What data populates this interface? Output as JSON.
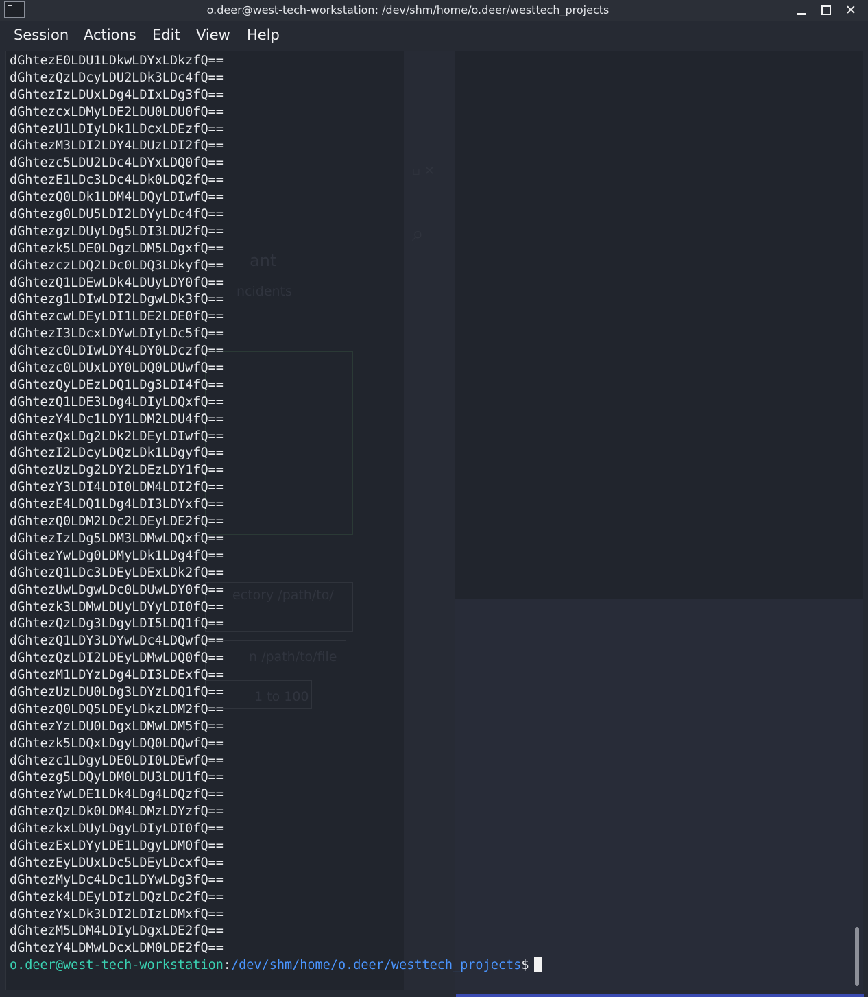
{
  "window": {
    "title": "o.deer@west-tech-workstation: /dev/shm/home/o.deer/westtech_projects",
    "app_icon": "terminal-icon",
    "controls": [
      "minimize-icon",
      "maximize-icon",
      "close-icon"
    ]
  },
  "menu": {
    "items": [
      "Session",
      "Actions",
      "Edit",
      "View",
      "Help"
    ]
  },
  "terminal": {
    "lines": [
      "dGhtezE0LDU1LDkwLDYxLDkzfQ==",
      "dGhtezQzLDcyLDU2LDk3LDc4fQ==",
      "dGhtezIzLDUxLDg4LDIxLDg3fQ==",
      "dGhtezcxLDMyLDE2LDU0LDU0fQ==",
      "dGhtezU1LDIyLDk1LDcxLDEzfQ==",
      "dGhtezM3LDI2LDY4LDUzLDI2fQ==",
      "dGhtezc5LDU2LDc4LDYxLDQ0fQ==",
      "dGhtezE1LDc3LDc4LDk0LDQ2fQ==",
      "dGhtezQ0LDk1LDM4LDQyLDIwfQ==",
      "dGhtezg0LDU5LDI2LDYyLDc4fQ==",
      "dGhtezgzLDUyLDg5LDI3LDU2fQ==",
      "dGhtezk5LDE0LDgzLDM5LDgxfQ==",
      "dGhtezczLDQ2LDc0LDQ3LDkyfQ==",
      "dGhtezQ1LDEwLDk4LDUyLDY0fQ==",
      "dGhtezg1LDIwLDI2LDgwLDk3fQ==",
      "dGhtezcwLDEyLDI1LDE2LDE0fQ==",
      "dGhtezI3LDcxLDYwLDIyLDc5fQ==",
      "dGhtezc0LDIwLDY4LDY0LDczfQ==",
      "dGhtezc0LDUxLDY0LDQ0LDUwfQ==",
      "dGhtezQyLDEzLDQ1LDg3LDI4fQ==",
      "dGhtezQ1LDE3LDg4LDIyLDQxfQ==",
      "dGhtezY4LDc1LDY1LDM2LDU4fQ==",
      "dGhtezQxLDg2LDk2LDEyLDIwfQ==",
      "dGhtezI2LDcyLDQzLDk1LDgyfQ==",
      "dGhtezUzLDg2LDY2LDEzLDY1fQ==",
      "dGhtezY3LDI4LDI0LDM4LDI2fQ==",
      "dGhtezE4LDQ1LDg4LDI3LDYxfQ==",
      "dGhtezQ0LDM2LDc2LDEyLDE2fQ==",
      "dGhtezIzLDg5LDM3LDMwLDQxfQ==",
      "dGhtezYwLDg0LDMyLDk1LDg4fQ==",
      "dGhtezQ1LDc3LDEyLDExLDk2fQ==",
      "dGhtezUwLDgwLDc0LDUwLDY0fQ==",
      "dGhtezk3LDMwLDUyLDYyLDI0fQ==",
      "dGhtezQzLDg3LDgyLDI5LDQ1fQ==",
      "dGhtezQ1LDY3LDYwLDc4LDQwfQ==",
      "dGhtezQzLDI2LDEyLDMwLDQ0fQ==",
      "dGhtezM1LDYzLDg4LDI3LDExfQ==",
      "dGhtezUzLDU0LDg3LDYzLDQ1fQ==",
      "dGhtezQ0LDQ5LDEyLDkzLDM2fQ==",
      "dGhtezYzLDU0LDgxLDMwLDM5fQ==",
      "dGhtezk5LDQxLDgyLDQ0LDQwfQ==",
      "dGhtezc1LDgyLDE0LDI0LDEwfQ==",
      "dGhtezg5LDQyLDM0LDU3LDU1fQ==",
      "dGhtezYwLDE1LDk4LDg4LDQzfQ==",
      "dGhtezQzLDk0LDM4LDMzLDYzfQ==",
      "dGhtezkxLDUyLDgyLDIyLDI0fQ==",
      "dGhtezExLDYyLDE1LDgyLDM0fQ==",
      "dGhtezEyLDUxLDc5LDEyLDcxfQ==",
      "dGhtezMyLDc4LDc1LDYwLDg3fQ==",
      "dGhtezk4LDEyLDIzLDQzLDc2fQ==",
      "dGhtezYxLDk3LDI2LDIzLDMxfQ==",
      "dGhtezM5LDM4LDIyLDgxLDE2fQ==",
      "dGhtezY4LDMwLDcxLDM0LDE2fQ=="
    ],
    "prompt": {
      "user_host": "o.deer@west-tech-workstation",
      "colon": ":",
      "path": "/dev/shm/home/o.deer/westtech_projects",
      "dollar": "$"
    }
  },
  "background_ghost_text": [
    "ant",
    "ncidents",
    "ectory /path/to/",
    "n /path/to/file",
    "1 to 100"
  ],
  "colors": {
    "terminal_bg": "#21252d",
    "text": "#e7e9ec",
    "prompt_user": "#3ad1b2",
    "prompt_path": "#4a95ff"
  }
}
